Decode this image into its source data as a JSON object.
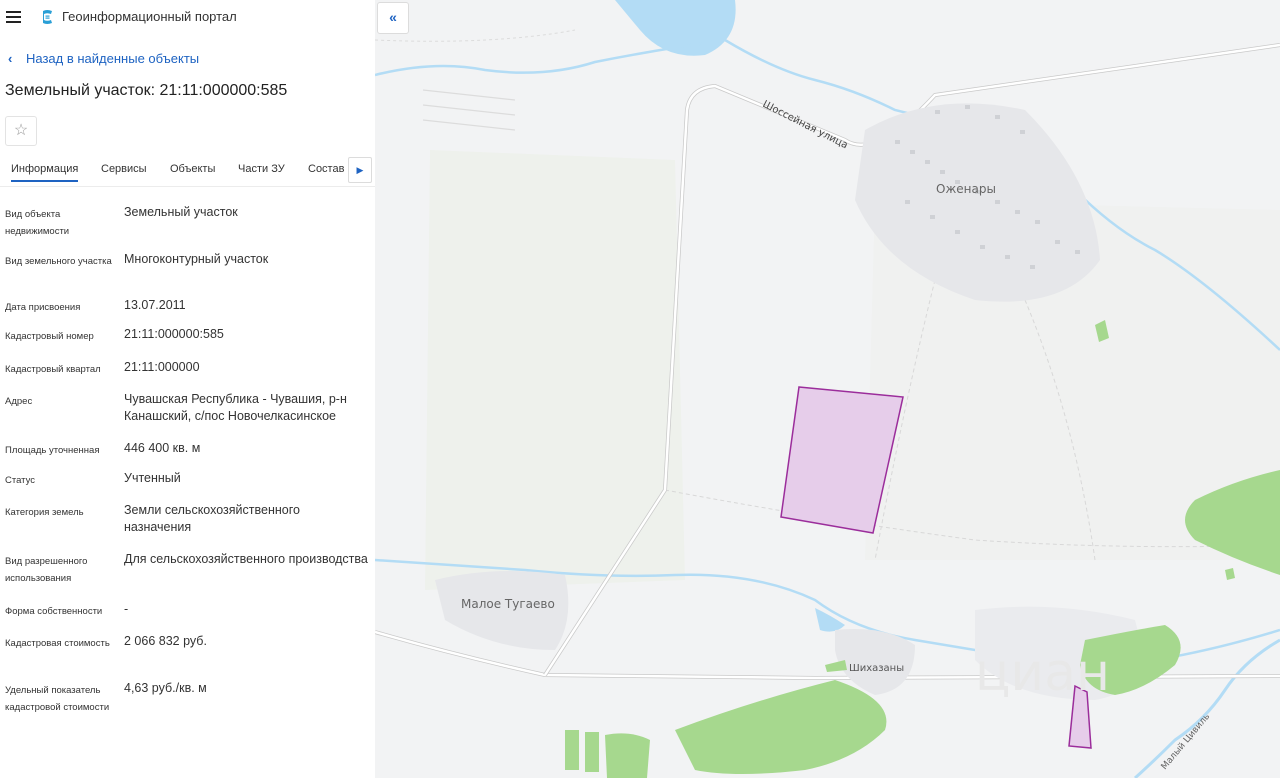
{
  "header": {
    "title": "Геоинформационный портал",
    "menu_icon": "hamburger-icon",
    "logo_icon": "portal-logo-icon"
  },
  "nav": {
    "back_label": "Назад в найденные объекты"
  },
  "object": {
    "title": "Земельный участок: 21:11:000000:585"
  },
  "tabs": [
    {
      "label": "Информация",
      "active": true
    },
    {
      "label": "Сервисы"
    },
    {
      "label": "Объекты"
    },
    {
      "label": "Части ЗУ"
    },
    {
      "label": "Состав"
    }
  ],
  "fields": [
    {
      "label": "Вид объекта недвижимости",
      "value": "Земельный участок"
    },
    {
      "label": "Вид земельного участка",
      "value": "Многоконтурный участок"
    },
    {
      "label": "Дата присвоения",
      "value": "13.07.2011"
    },
    {
      "label": "Кадастровый номер",
      "value": "21:11:000000:585"
    },
    {
      "label": "Кадастровый квартал",
      "value": "21:11:000000"
    },
    {
      "label": "Адрес",
      "value": "Чувашская Республика - Чувашия, р-н Канашский, с/пос Новочелкасинское"
    },
    {
      "label": "Площадь уточненная",
      "value": "446 400 кв. м"
    },
    {
      "label": "Статус",
      "value": "Учтенный"
    },
    {
      "label": "Категория земель",
      "value": "Земли сельскохозяйственного назначения"
    },
    {
      "label": "Вид разрешенного использования",
      "value": "Для сельскохозяйственного производства"
    },
    {
      "label": "Форма собственности",
      "value": "-"
    },
    {
      "label": "Кадастровая стоимость",
      "value": "2 066 832 руб."
    },
    {
      "label": "Удельный показатель кадастровой стоимости",
      "value": "4,63 руб./кв. м"
    }
  ],
  "map": {
    "labels": {
      "street": "Шоссейная улица",
      "village1": "Оженары",
      "village2": "Малое Тугаево",
      "village3": "Шихазаны",
      "watermark": "циан",
      "river": "Малый Цивиль"
    },
    "colors": {
      "parcel_fill": "#e6cdea",
      "parcel_stroke": "#9b2d9b",
      "forest": "#a6d88e",
      "water": "#b3dcf5",
      "background": "#f2f3f4"
    }
  }
}
